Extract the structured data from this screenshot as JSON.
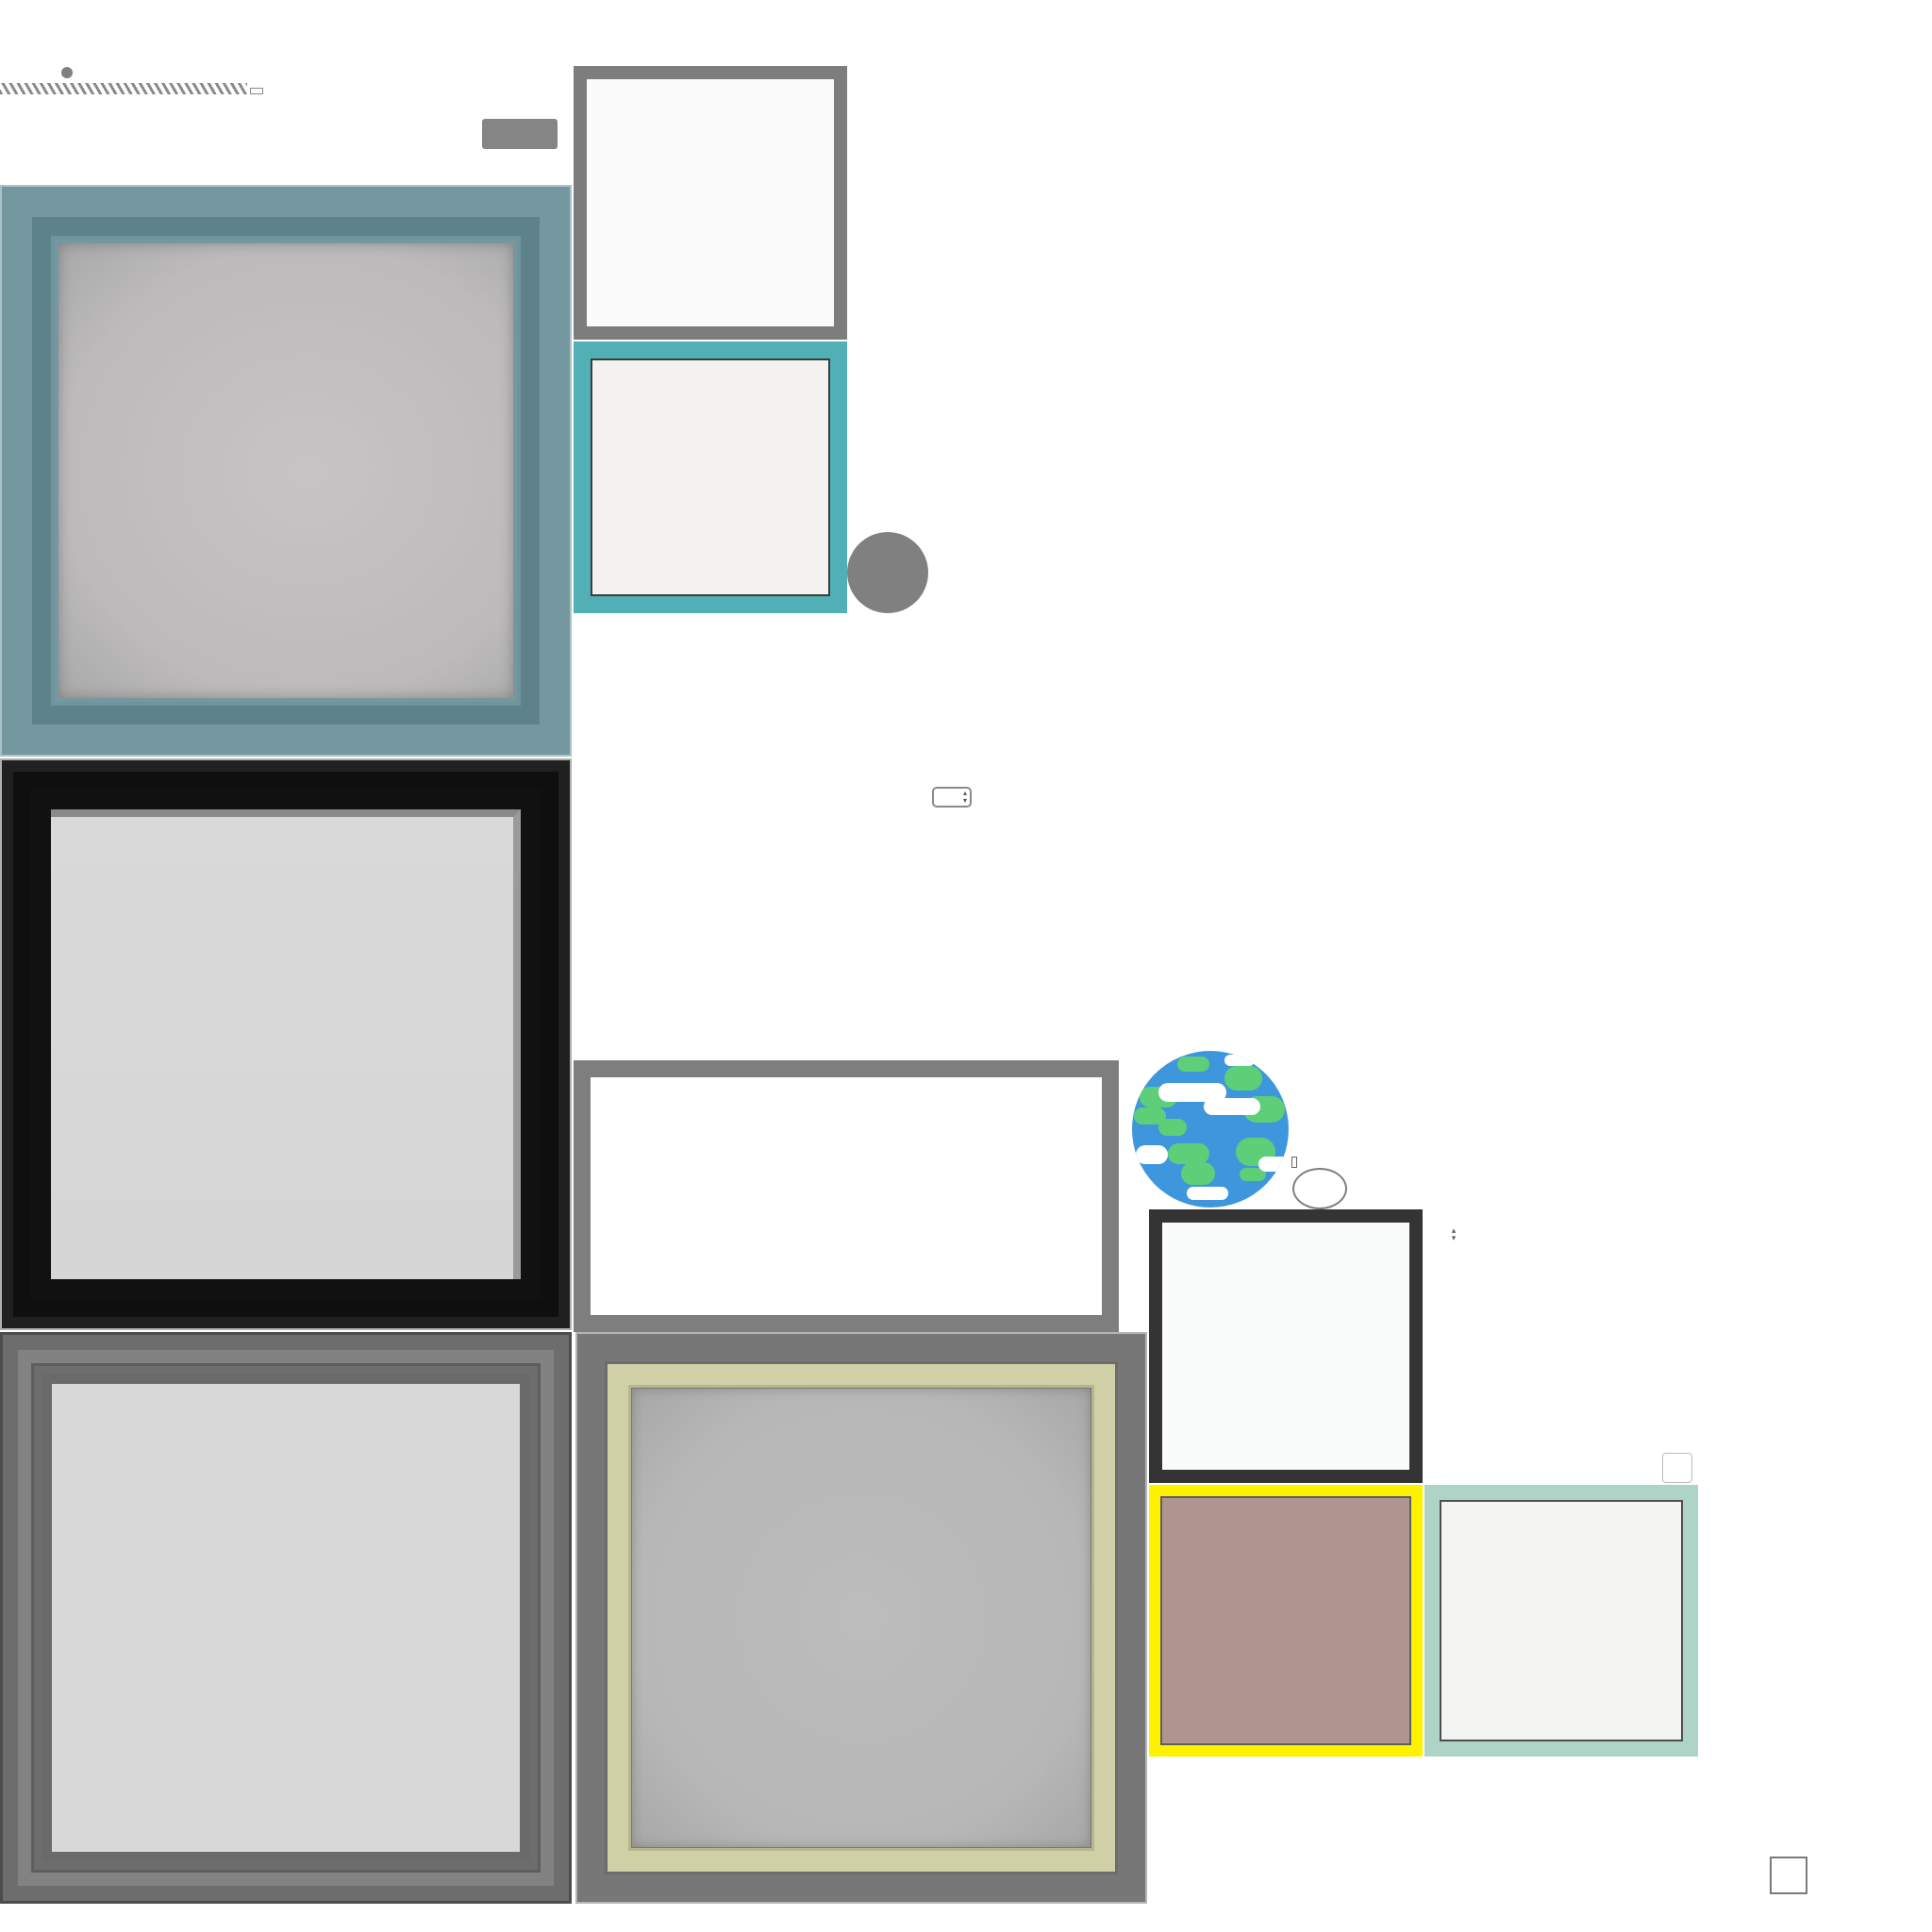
{
  "icons": {
    "globe": "globe-icon",
    "stepper_up": "▴",
    "stepper_down": "▾",
    "sort": "⇕"
  },
  "colors": {
    "blue_frame": "#7598a0",
    "teal_frame": "#50b0b5",
    "yellow_frame": "#fff200",
    "mint_frame": "#aed4c7",
    "olive_frame": "#cfd0a6",
    "globe_ocean": "#3e97dd",
    "globe_land": "#5dcf78"
  },
  "slider": {
    "value": 0.27
  }
}
